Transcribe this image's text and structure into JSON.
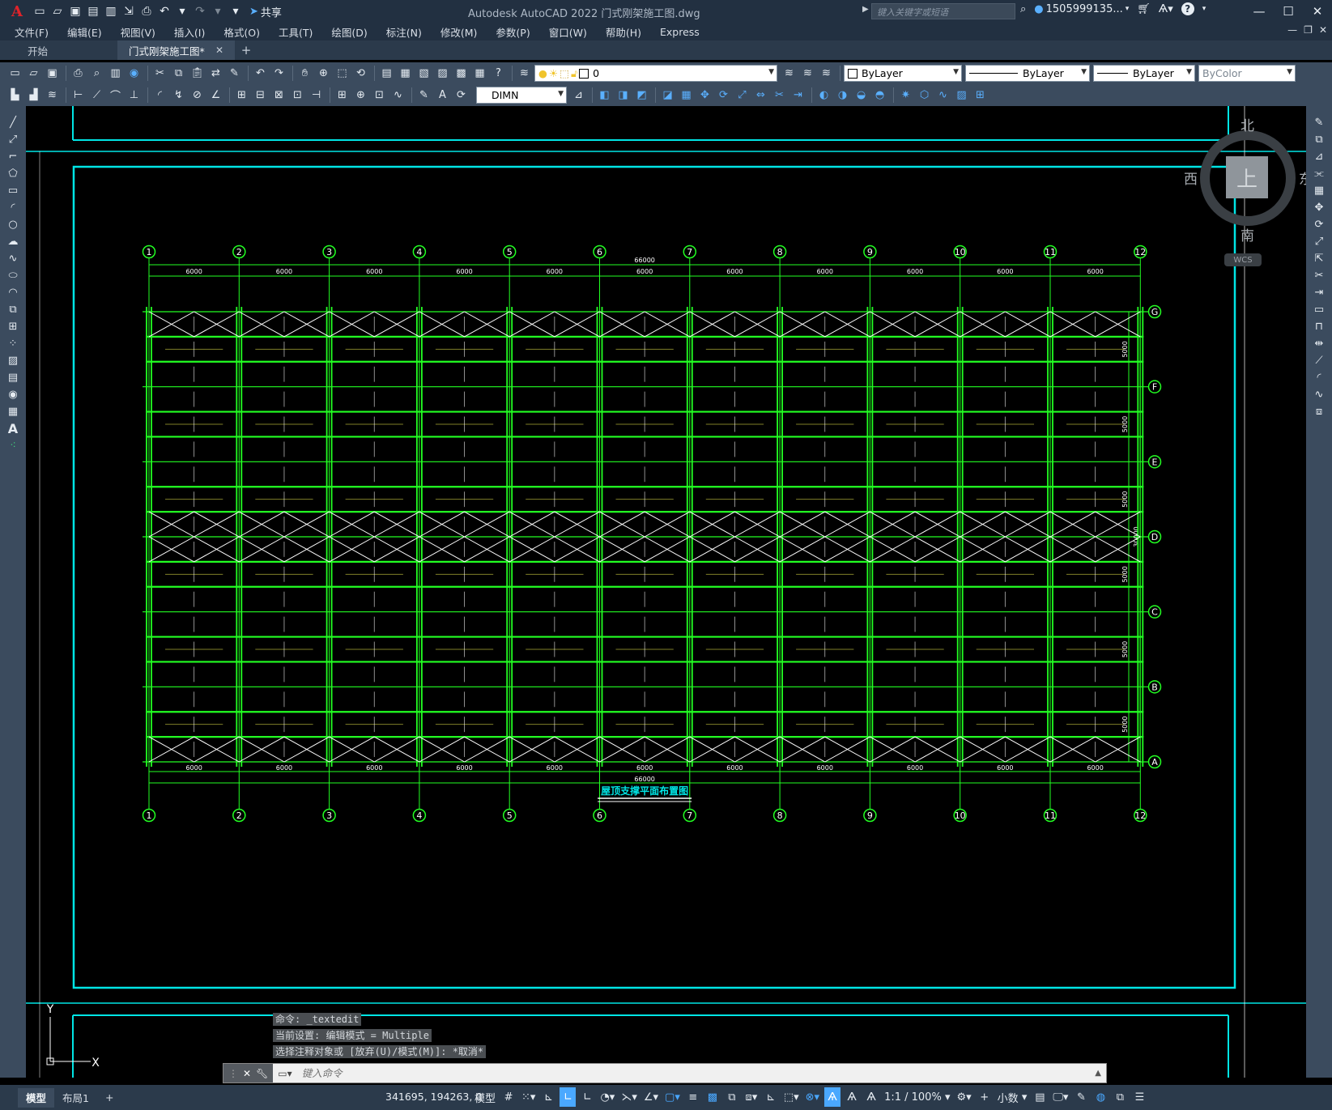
{
  "app": {
    "title": "Autodesk AutoCAD 2022    门式刚架施工图.dwg",
    "share_label": "共享",
    "search_placeholder": "键入关键字或短语",
    "user": "1505999135...",
    "logo": "A"
  },
  "menu": [
    "文件(F)",
    "编辑(E)",
    "视图(V)",
    "插入(I)",
    "格式(O)",
    "工具(T)",
    "绘图(D)",
    "标注(N)",
    "修改(M)",
    "参数(P)",
    "窗口(W)",
    "帮助(H)",
    "Express"
  ],
  "tabs": {
    "start": "开始",
    "active": "门式刚架施工图*"
  },
  "toolbar": {
    "layer": "0",
    "color": "ByLayer",
    "linetype": "ByLayer",
    "lineweight": "ByLayer",
    "plotstyle": "ByColor",
    "dimstyle": "DIMN"
  },
  "viewcube": {
    "north": "北",
    "south": "南",
    "east": "东",
    "west": "西",
    "face": "上",
    "wcs": "WCS"
  },
  "drawing": {
    "title": "屋顶支撑平面布置图",
    "col_labels": [
      "1",
      "2",
      "3",
      "4",
      "5",
      "6",
      "7",
      "8",
      "9",
      "10",
      "11",
      "12"
    ],
    "row_labels": [
      "G",
      "F",
      "E",
      "D",
      "C",
      "B",
      "A"
    ],
    "bay_dim": "6000",
    "total_dim": "66000",
    "row_dim": "5000",
    "total_row_dim": "30000",
    "colors": {
      "frame": "#00e5e5",
      "grid": "#22ff22",
      "white": "#ffffff",
      "yellow": "#e8e84a"
    }
  },
  "ucs": {
    "x": "X",
    "y": "Y"
  },
  "command": {
    "history": [
      "命令: _textedit",
      "当前设置: 编辑模式 = Multiple",
      "选择注释对象或 [放弃(U)/模式(M)]: *取消*"
    ],
    "placeholder": "键入命令"
  },
  "status": {
    "model_tab": "模型",
    "layout_tab": "布局1",
    "coords": "341695, 194263, 0",
    "model_btn": "模型",
    "scale": "1:1 / 100%",
    "units": "小数"
  }
}
